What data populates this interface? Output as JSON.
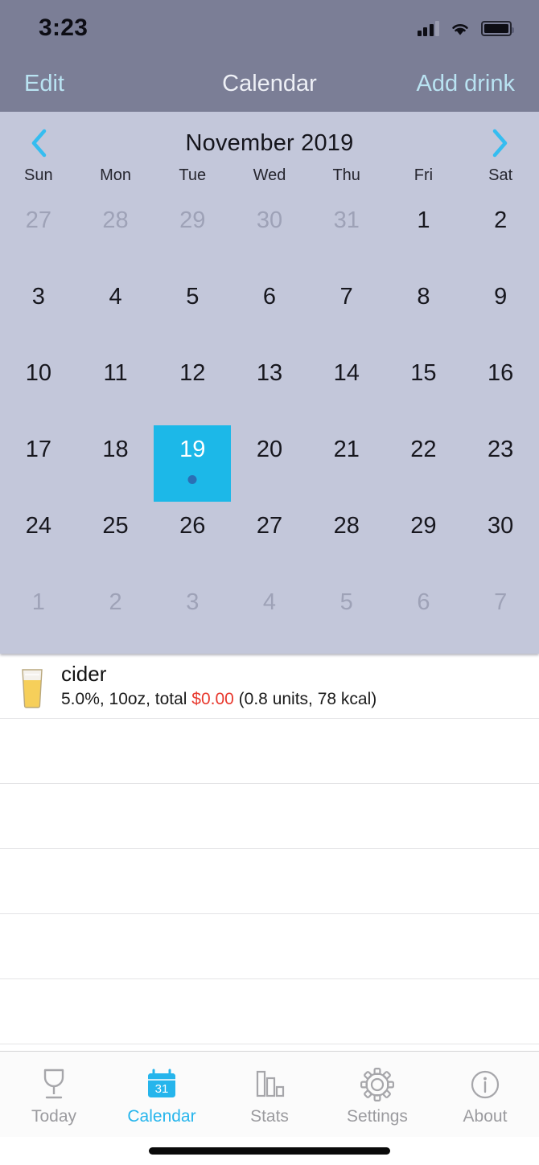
{
  "status_bar": {
    "time": "3:23",
    "signal_icon": "cellular-signal-icon",
    "wifi_icon": "wifi-icon",
    "battery_icon": "battery-full-icon"
  },
  "nav_bar": {
    "left_button": "Edit",
    "title": "Calendar",
    "right_button": "Add drink"
  },
  "calendar": {
    "prev_icon": "chevron-left-icon",
    "next_icon": "chevron-right-icon",
    "month_label": "November 2019",
    "weekdays": [
      "Sun",
      "Mon",
      "Tue",
      "Wed",
      "Thu",
      "Fri",
      "Sat"
    ],
    "accent_color": "#1cb8e8",
    "panel_color": "#c3c7da",
    "days": [
      {
        "label": "27",
        "muted": true,
        "selected": false,
        "dot": false
      },
      {
        "label": "28",
        "muted": true,
        "selected": false,
        "dot": false
      },
      {
        "label": "29",
        "muted": true,
        "selected": false,
        "dot": false
      },
      {
        "label": "30",
        "muted": true,
        "selected": false,
        "dot": false
      },
      {
        "label": "31",
        "muted": true,
        "selected": false,
        "dot": false
      },
      {
        "label": "1",
        "muted": false,
        "selected": false,
        "dot": false
      },
      {
        "label": "2",
        "muted": false,
        "selected": false,
        "dot": false
      },
      {
        "label": "3",
        "muted": false,
        "selected": false,
        "dot": false
      },
      {
        "label": "4",
        "muted": false,
        "selected": false,
        "dot": false
      },
      {
        "label": "5",
        "muted": false,
        "selected": false,
        "dot": false
      },
      {
        "label": "6",
        "muted": false,
        "selected": false,
        "dot": false
      },
      {
        "label": "7",
        "muted": false,
        "selected": false,
        "dot": false
      },
      {
        "label": "8",
        "muted": false,
        "selected": false,
        "dot": false
      },
      {
        "label": "9",
        "muted": false,
        "selected": false,
        "dot": false
      },
      {
        "label": "10",
        "muted": false,
        "selected": false,
        "dot": false
      },
      {
        "label": "11",
        "muted": false,
        "selected": false,
        "dot": false
      },
      {
        "label": "12",
        "muted": false,
        "selected": false,
        "dot": false
      },
      {
        "label": "13",
        "muted": false,
        "selected": false,
        "dot": false
      },
      {
        "label": "14",
        "muted": false,
        "selected": false,
        "dot": false
      },
      {
        "label": "15",
        "muted": false,
        "selected": false,
        "dot": false
      },
      {
        "label": "16",
        "muted": false,
        "selected": false,
        "dot": false
      },
      {
        "label": "17",
        "muted": false,
        "selected": false,
        "dot": false
      },
      {
        "label": "18",
        "muted": false,
        "selected": false,
        "dot": false
      },
      {
        "label": "19",
        "muted": false,
        "selected": true,
        "dot": true
      },
      {
        "label": "20",
        "muted": false,
        "selected": false,
        "dot": false
      },
      {
        "label": "21",
        "muted": false,
        "selected": false,
        "dot": false
      },
      {
        "label": "22",
        "muted": false,
        "selected": false,
        "dot": false
      },
      {
        "label": "23",
        "muted": false,
        "selected": false,
        "dot": false
      },
      {
        "label": "24",
        "muted": false,
        "selected": false,
        "dot": false
      },
      {
        "label": "25",
        "muted": false,
        "selected": false,
        "dot": false
      },
      {
        "label": "26",
        "muted": false,
        "selected": false,
        "dot": false
      },
      {
        "label": "27",
        "muted": false,
        "selected": false,
        "dot": false
      },
      {
        "label": "28",
        "muted": false,
        "selected": false,
        "dot": false
      },
      {
        "label": "29",
        "muted": false,
        "selected": false,
        "dot": false
      },
      {
        "label": "30",
        "muted": false,
        "selected": false,
        "dot": false
      },
      {
        "label": "1",
        "muted": true,
        "selected": false,
        "dot": false
      },
      {
        "label": "2",
        "muted": true,
        "selected": false,
        "dot": false
      },
      {
        "label": "3",
        "muted": true,
        "selected": false,
        "dot": false
      },
      {
        "label": "4",
        "muted": true,
        "selected": false,
        "dot": false
      },
      {
        "label": "5",
        "muted": true,
        "selected": false,
        "dot": false
      },
      {
        "label": "6",
        "muted": true,
        "selected": false,
        "dot": false
      },
      {
        "label": "7",
        "muted": true,
        "selected": false,
        "dot": false
      }
    ]
  },
  "drink_list": {
    "entries": [
      {
        "icon": "beer-glass-icon",
        "name": "cider",
        "detail_prefix": "5.0%, 10oz, total ",
        "price": "$0.00",
        "detail_suffix": " (0.8 units, 78 kcal)",
        "price_color": "#e8392e"
      }
    ],
    "empty_row_count": 5
  },
  "tab_bar": {
    "active_color": "#26b5ec",
    "inactive_color": "#9b9b9f",
    "tabs": [
      {
        "label": "Today",
        "icon": "wine-glass-icon",
        "active": false
      },
      {
        "label": "Calendar",
        "icon": "calendar-31-icon",
        "active": true,
        "icon_day": "31"
      },
      {
        "label": "Stats",
        "icon": "bar-chart-icon",
        "active": false
      },
      {
        "label": "Settings",
        "icon": "gear-icon",
        "active": false
      },
      {
        "label": "About",
        "icon": "info-circle-icon",
        "active": false
      }
    ]
  }
}
